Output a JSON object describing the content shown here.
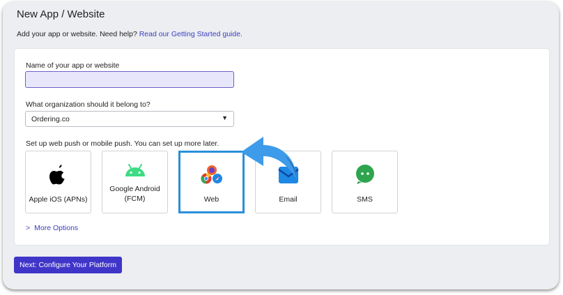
{
  "header": {
    "title": "New App / Website",
    "subtitle_text": "Add your app or website. Need help?",
    "subtitle_link": "Read our Getting Started guide."
  },
  "form": {
    "name_label": "Name of your app or website",
    "name_value": "",
    "org_label": "What organization should it belong to?",
    "org_value": "Ordering.co",
    "platform_label": "Set up web push or mobile push. You can set up more later.",
    "platforms": [
      {
        "label": "Apple iOS (APNs)",
        "icon": "apple-icon",
        "selected": false
      },
      {
        "label": "Google Android (FCM)",
        "icon": "android-icon",
        "selected": false
      },
      {
        "label": "Web",
        "icon": "browsers-icon",
        "selected": true
      },
      {
        "label": "Email",
        "icon": "email-icon",
        "selected": false
      },
      {
        "label": "SMS",
        "icon": "sms-icon",
        "selected": false
      }
    ],
    "more_options": "More Options"
  },
  "footer": {
    "next_label": "Next: Configure Your Platform"
  },
  "colors": {
    "accent": "#3f35c8",
    "link": "#3b3fbf",
    "selected_border": "#2a8fd9",
    "arrow": "#3d9be9"
  }
}
